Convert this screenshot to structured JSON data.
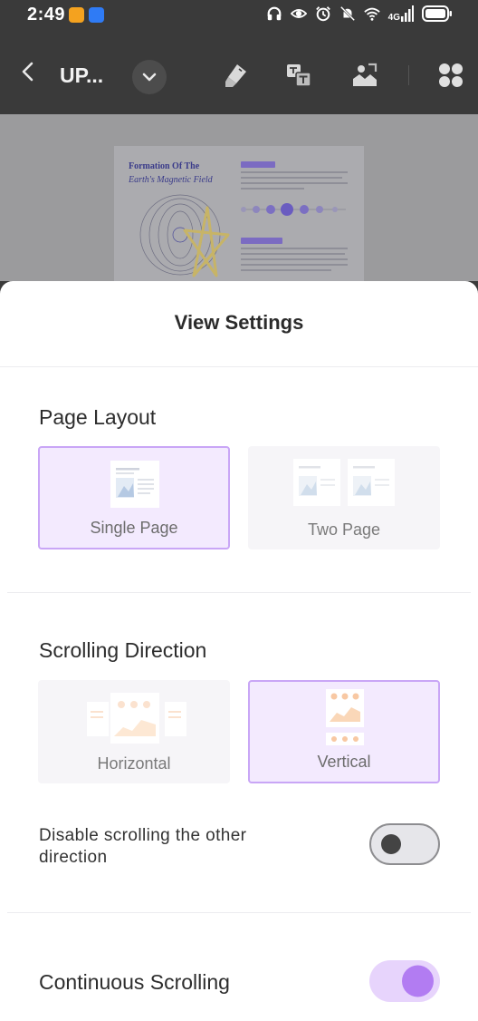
{
  "status_bar": {
    "time": "2:49",
    "network": "4G",
    "icons": [
      "headphones-icon",
      "eye-icon",
      "alarm-icon",
      "mute-icon",
      "wifi-icon",
      "signal-icon",
      "battery-icon"
    ]
  },
  "toolbar": {
    "title": "UP...",
    "icons": [
      "back-icon",
      "chevron-down-icon",
      "highlighter-icon",
      "translate-icon",
      "image-edit-icon",
      "apps-icon"
    ]
  },
  "document_preview": {
    "heading_line1": "Formation Of The",
    "heading_line2": "Earth's Magnetic Field"
  },
  "sheet": {
    "title": "View Settings",
    "page_layout": {
      "title": "Page Layout",
      "options": [
        {
          "label": "Single Page",
          "selected": true
        },
        {
          "label": "Two Page",
          "selected": false
        }
      ]
    },
    "scrolling_direction": {
      "title": "Scrolling Direction",
      "options": [
        {
          "label": "Horizontal",
          "selected": false
        },
        {
          "label": "Vertical",
          "selected": true
        }
      ],
      "disable_other": {
        "label": "Disable scrolling the other direction",
        "enabled": false
      }
    },
    "continuous_scrolling": {
      "label": "Continuous Scrolling",
      "enabled": true
    }
  },
  "colors": {
    "accent": "#b27cf2",
    "selected_border": "#c9a6f6",
    "selected_bg": "#f3eafe",
    "toolbar_bg": "#3a3a3a"
  }
}
